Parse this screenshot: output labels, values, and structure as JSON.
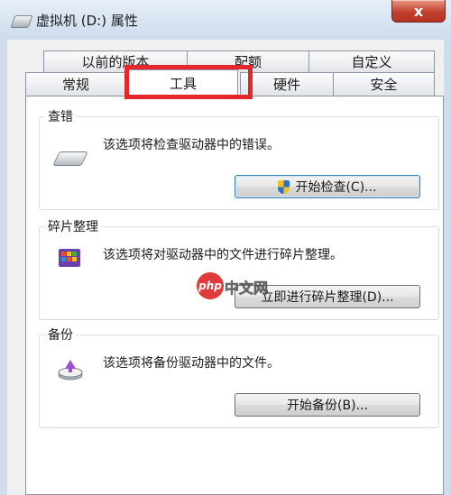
{
  "window": {
    "title": "虚拟机 (D:) 属性",
    "close_glyph": "x"
  },
  "tabs": {
    "row_back": [
      {
        "label": "以前的版本"
      },
      {
        "label": "配额"
      },
      {
        "label": "自定义"
      }
    ],
    "row_front": [
      {
        "label": "常规"
      },
      {
        "label": "工具",
        "active": true
      },
      {
        "label": "硬件"
      },
      {
        "label": "安全"
      }
    ]
  },
  "groups": {
    "error_check": {
      "title": "查错",
      "description": "该选项将检查驱动器中的错误。",
      "button": "开始检查(C)...",
      "icon": "drive-icon"
    },
    "defrag": {
      "title": "碎片整理",
      "description": "该选项将对驱动器中的文件进行碎片整理。",
      "button": "立即进行碎片整理(D)...",
      "icon": "defrag-icon"
    },
    "backup": {
      "title": "备份",
      "description": "该选项将备份驱动器中的文件。",
      "button": "开始备份(B)...",
      "icon": "backup-icon"
    }
  },
  "watermark": {
    "badge": "php",
    "text": "中文网"
  },
  "colors": {
    "highlight": "#e5262d",
    "close_button": "#c2412f",
    "panel_background": "#ffffff",
    "dialog_background": "#f0f0f0"
  }
}
